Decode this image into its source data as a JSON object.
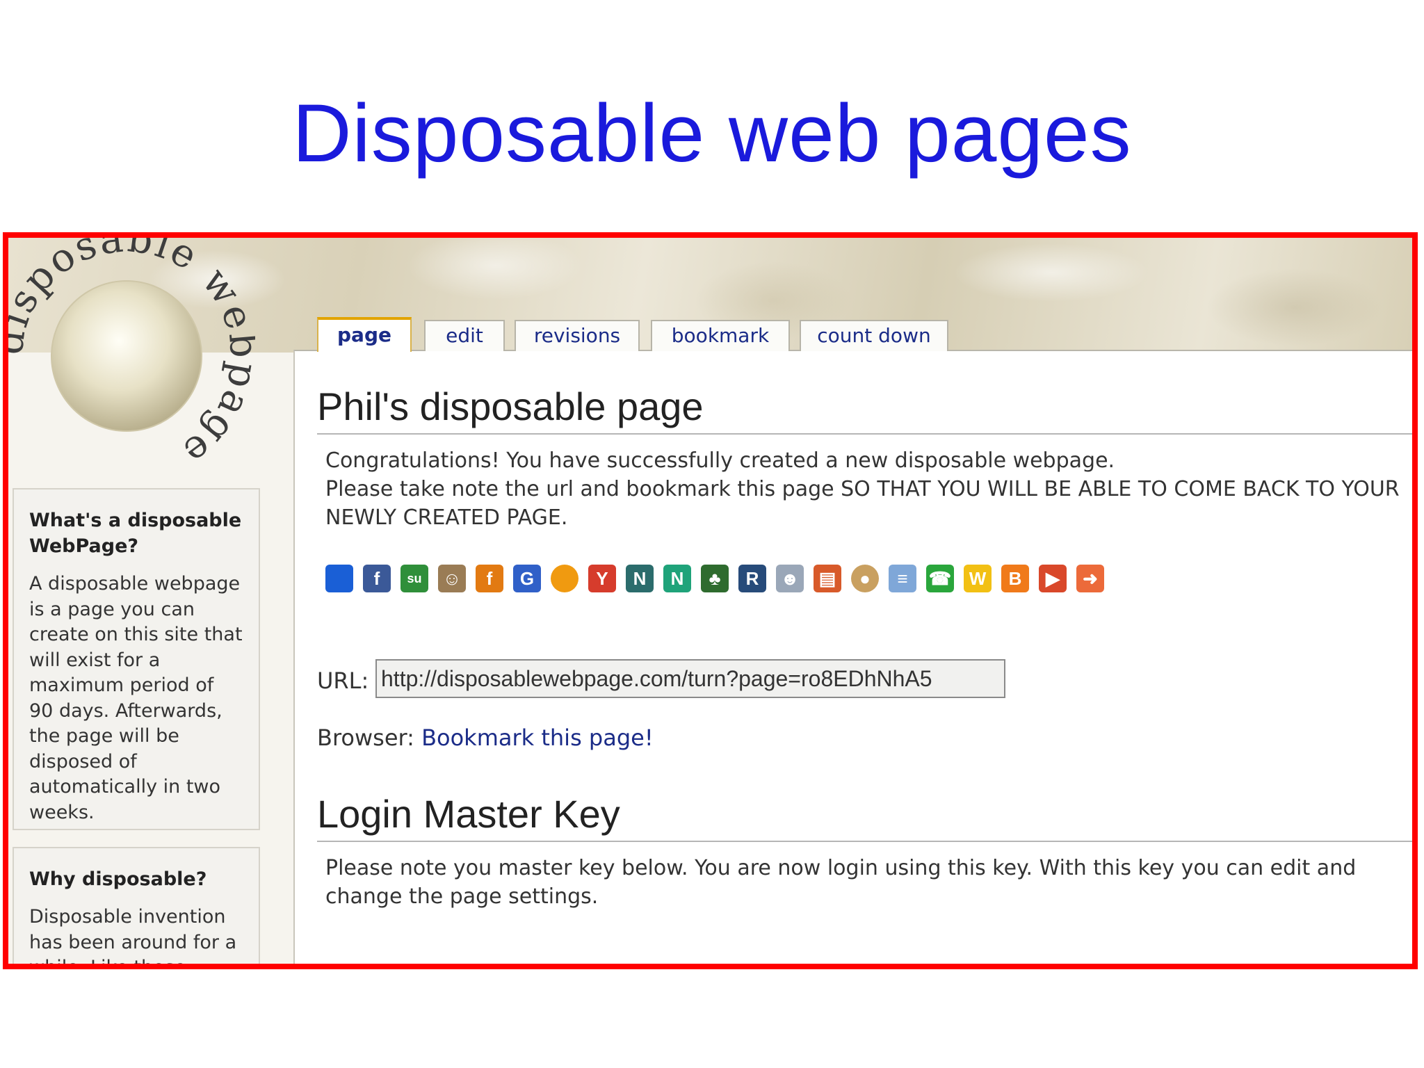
{
  "slide": {
    "title": "Disposable web pages"
  },
  "logo": {
    "ring_text": "disposable webpage"
  },
  "sidebar": [
    {
      "heading": "What's a disposable WebPage?",
      "text": "A disposable webpage is a page you can create on this site that will exist for a maximum period of 90 days. Afterwards, the page will be disposed of automatically in two weeks."
    },
    {
      "heading": "Why disposable?",
      "text": "Disposable invention has been around for a while. Like those inventions, a"
    }
  ],
  "tabs": [
    {
      "label": "page",
      "active": true
    },
    {
      "label": "edit"
    },
    {
      "label": "revisions"
    },
    {
      "label": "bookmark"
    },
    {
      "label": "count down"
    }
  ],
  "page": {
    "heading": "Phil's disposable page",
    "message_line1": "Congratulations! You have successfully created a new disposable webpage.",
    "message_line2": "Please take note the url and bookmark this page SO THAT YOU WILL BE ABLE TO COME BACK TO YOUR NEWLY CREATED PAGE.",
    "url_label": "URL:",
    "url_value": "http://disposablewebpage.com/turn?page=ro8EDhNhA5",
    "browser_label": "Browser:",
    "bookmark_link": "Bookmark this page!",
    "login_heading": "Login Master Key",
    "login_message": "Please note you master key below. You are now login using this key. With this key you can edit and change the page settings."
  },
  "share_icons": [
    {
      "name": "delicious-icon",
      "glyph": "",
      "color": "#1a5fd6"
    },
    {
      "name": "facebook-icon",
      "glyph": "f",
      "color": "#3b5998"
    },
    {
      "name": "stumbleupon-icon",
      "glyph": "su",
      "color": "#2f8f3a"
    },
    {
      "name": "avatar-icon",
      "glyph": "☺",
      "color": "#9a7c55"
    },
    {
      "name": "furl-icon",
      "glyph": "f",
      "color": "#e27a12"
    },
    {
      "name": "google-icon",
      "glyph": "G",
      "color": "#3060c8"
    },
    {
      "name": "orange-circle-icon",
      "glyph": "",
      "color": "#f09a10"
    },
    {
      "name": "yahoo-icon",
      "glyph": "Y",
      "color": "#d63c2c"
    },
    {
      "name": "netscape-icon",
      "glyph": "N",
      "color": "#2b6c6c"
    },
    {
      "name": "newsvine-icon",
      "glyph": "N",
      "color": "#1fa37a"
    },
    {
      "name": "leaf-icon",
      "glyph": "♣",
      "color": "#2e6b2e"
    },
    {
      "name": "rss-icon",
      "glyph": "R",
      "color": "#274b7a"
    },
    {
      "name": "reddit-icon",
      "glyph": "☻",
      "color": "#9aa7b8"
    },
    {
      "name": "tools-icon",
      "glyph": "▤",
      "color": "#d85a2a"
    },
    {
      "name": "dots-icon",
      "glyph": "●",
      "color": "#c9a060"
    },
    {
      "name": "document-icon",
      "glyph": "≡",
      "color": "#7fa7d8"
    },
    {
      "name": "chat-icon",
      "glyph": "☎",
      "color": "#2aa63c"
    },
    {
      "name": "w-icon",
      "glyph": "W",
      "color": "#f2c014"
    },
    {
      "name": "blogger-icon",
      "glyph": "B",
      "color": "#f07a1a"
    },
    {
      "name": "play-icon",
      "glyph": "▶",
      "color": "#d9482a"
    },
    {
      "name": "share-arrow-icon",
      "glyph": "➜",
      "color": "#ec6a3a"
    }
  ]
}
